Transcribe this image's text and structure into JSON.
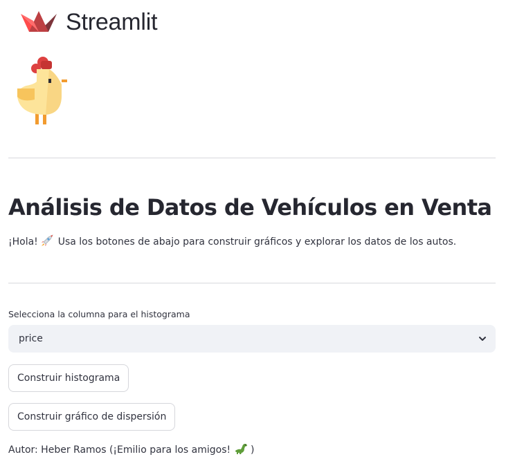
{
  "app": {
    "logo_text": "Streamlit"
  },
  "page": {
    "title": "Análisis de Datos de Vehículos en Venta",
    "intro_greeting": "¡Hola!",
    "intro_text": "Usa los botones de abajo para construir gráficos y explorar los datos de los autos.",
    "intro_emoji": "rocket-icon"
  },
  "histogram_select": {
    "label": "Selecciona la columna para el histograma",
    "value": "price"
  },
  "buttons": {
    "histogram": "Construir histograma",
    "scatter": "Construir gráfico de dispersión"
  },
  "footer": {
    "author_prefix": "Autor: Heber Ramos (¡Emilio para los amigos!",
    "author_suffix": ")",
    "author_emoji": "dinosaur-icon"
  },
  "colors": {
    "accent": "#ff4b4b",
    "text": "#31333f",
    "select_bg": "#f0f2f6"
  }
}
